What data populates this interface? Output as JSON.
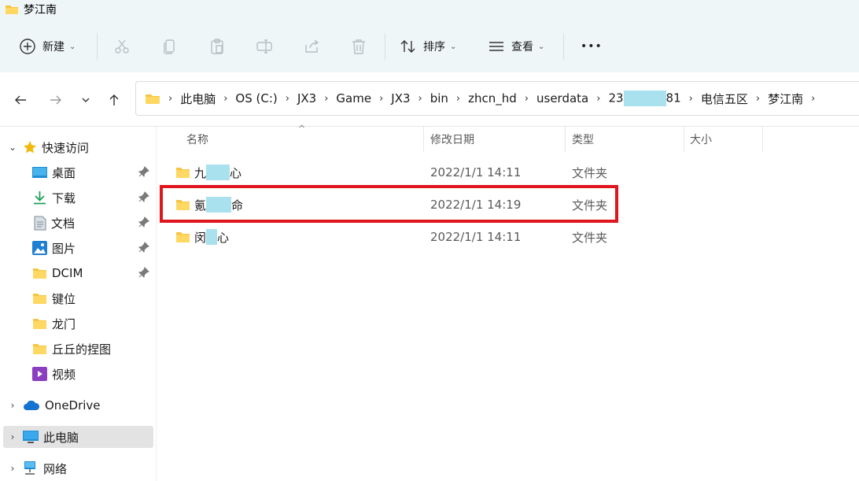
{
  "window": {
    "title": "梦江南"
  },
  "toolbar": {
    "new_label": "新建",
    "sort_label": "排序",
    "view_label": "查看",
    "more_label": "•••"
  },
  "breadcrumb": {
    "items": [
      "此电脑",
      "OS (C:)",
      "JX3",
      "Game",
      "JX3",
      "bin",
      "zhcn_hd",
      "userdata"
    ],
    "account_prefix": "23",
    "account_suffix": "81",
    "tail": [
      "电信五区",
      "梦江南"
    ]
  },
  "sidebar": {
    "quick_access": "快速访问",
    "items": [
      {
        "label": "桌面",
        "pinned": true
      },
      {
        "label": "下载",
        "pinned": true
      },
      {
        "label": "文档",
        "pinned": true
      },
      {
        "label": "图片",
        "pinned": true
      },
      {
        "label": "DCIM",
        "pinned": true
      },
      {
        "label": "键位",
        "pinned": false
      },
      {
        "label": "龙门",
        "pinned": false
      },
      {
        "label": "丘丘的捏图",
        "pinned": false
      },
      {
        "label": "视频",
        "pinned": false
      }
    ],
    "onedrive": "OneDrive",
    "this_pc": "此电脑",
    "network": "网络"
  },
  "columns": {
    "name": "名称",
    "modified": "修改日期",
    "type": "类型",
    "size": "大小"
  },
  "files": [
    {
      "name_start": "九",
      "name_end": "心",
      "modified": "2022/1/1 14:11",
      "type": "文件夹"
    },
    {
      "name_start": "氪",
      "name_end": "命",
      "modified": "2022/1/1 14:19",
      "type": "文件夹"
    },
    {
      "name_start": "闵",
      "name_end": "心",
      "modified": "2022/1/1 14:11",
      "type": "文件夹"
    }
  ],
  "colors": {
    "accent_redaction": "#a9e1ef",
    "highlight_box": "#e0161e",
    "folder": "#f5c443"
  }
}
